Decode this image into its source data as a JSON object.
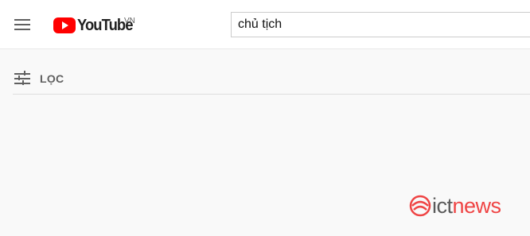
{
  "header": {
    "logo_text": "YouTube",
    "region_code": "VN",
    "search": {
      "value": "chủ tịch",
      "placeholder": ""
    }
  },
  "filter": {
    "label": "LỌC"
  },
  "watermark": {
    "part1": "ict",
    "part2": "news",
    "colors": {
      "ict": "#5a5a5a",
      "news": "#ef4444"
    }
  },
  "icons": [
    "menu-icon",
    "youtube-logo-icon",
    "filter-sliders-icon",
    "ictnews-logo-icon"
  ],
  "colors": {
    "brand_red": "#ff0000",
    "background": "#f9f9f9"
  }
}
